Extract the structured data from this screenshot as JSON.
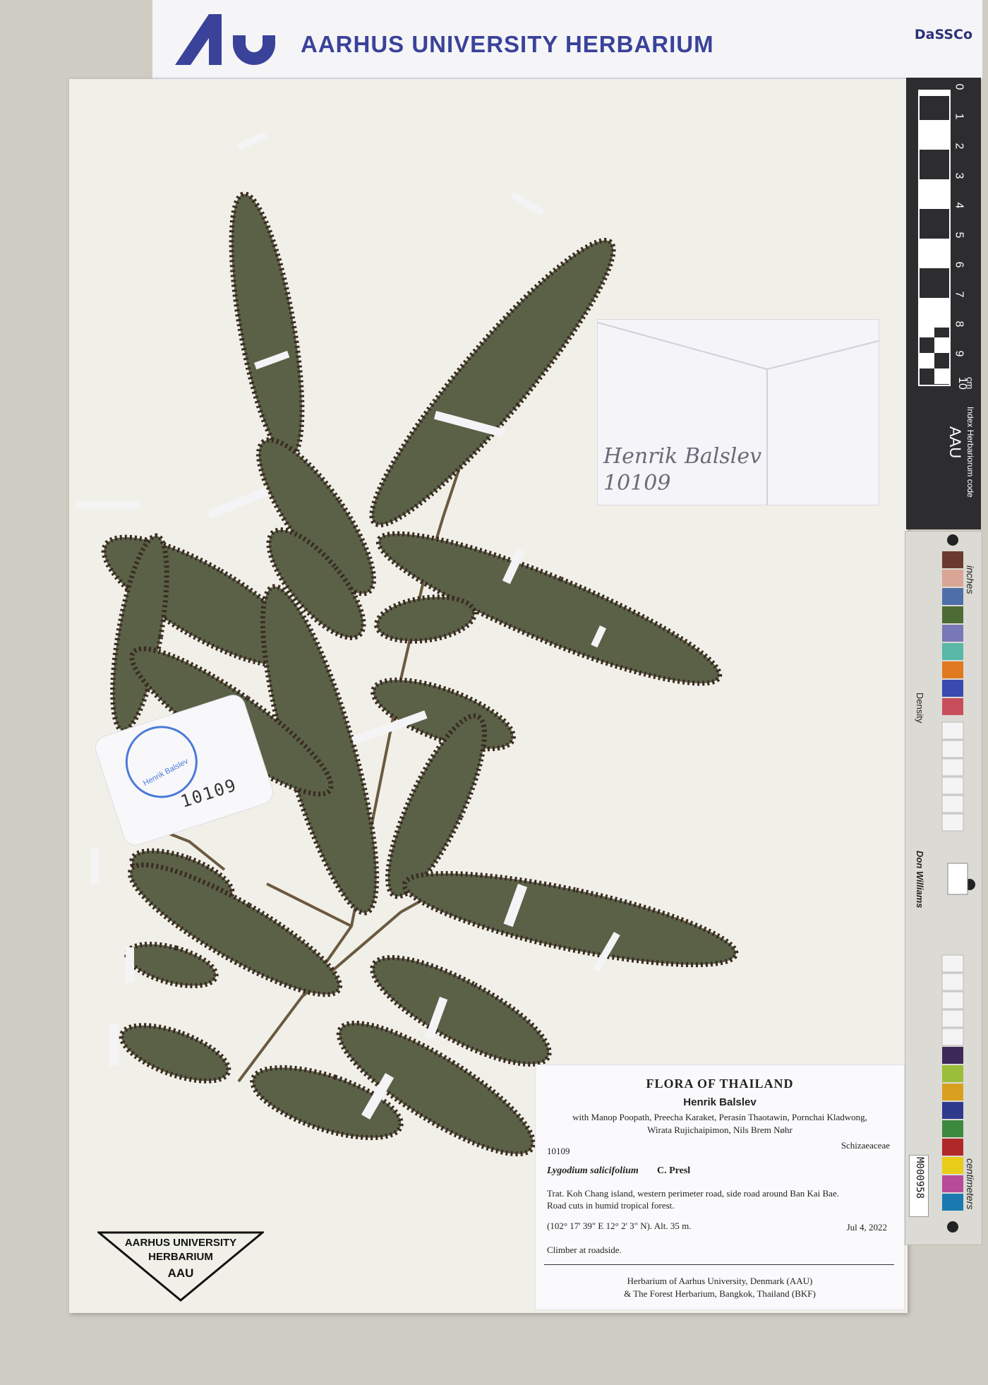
{
  "banner": {
    "title": "AARHUS UNIVERSITY HERBARIUM",
    "partner": "DaSSCo"
  },
  "envelope": {
    "line1": "Henrik Balslev",
    "line2": "10109"
  },
  "tag": {
    "number": "10109",
    "stamp": "Henrik Balslev"
  },
  "ruler": {
    "numbers": [
      "0",
      "1",
      "2",
      "3",
      "4",
      "5",
      "6",
      "7",
      "8",
      "9",
      "10"
    ],
    "unit": "cm",
    "code_label": "Index Herbariorum code",
    "code": "AAU"
  },
  "colorbar": {
    "inches": "inches",
    "centimeters": "centimeters",
    "density": "Density",
    "brand": "Don Williams",
    "barcode": "M000958",
    "swatch_colors": [
      "#6b3a2e",
      "#d9a595",
      "#4f6fa8",
      "#4d6b35",
      "#7878b8",
      "#59b8a8",
      "#e07a20",
      "#3a4ab0",
      "#c84e5c",
      "#3d2a5a",
      "#9bbe3a",
      "#d9a020",
      "#2e3a8c",
      "#3c8a40",
      "#b02828",
      "#e8cc1a",
      "#b84a9a",
      "#1a7ab0"
    ]
  },
  "label": {
    "title": "FLORA OF THAILAND",
    "collector": "Henrik Balslev",
    "with_line1": "with Manop Poopath, Preecha Karaket, Perasin Thaotawin, Pornchai Kladwong,",
    "with_line2": "Wirata Rujichaipimon, Nils Brem Nøhr",
    "family": "Schizaeaceae",
    "number": "10109",
    "species": "Lygodium salicifolium",
    "author": "C. Presl",
    "locality1": "Trat. Koh Chang island, western perimeter road, side road around Ban Kai Bae.",
    "locality2": "Road cuts in humid tropical forest.",
    "coords": "(102° 17' 39\" E 12° 2' 3\" N). Alt. 35 m.",
    "date": "Jul 4, 2022",
    "habit": "Climber at roadside.",
    "footer1": "Herbarium of Aarhus University, Denmark (AAU)",
    "footer2": "& The Forest Herbarium, Bangkok, Thailand (BKF)"
  },
  "stamp_triangle": {
    "line1": "AARHUS UNIVERSITY",
    "line2": "HERBARIUM",
    "line3": "AAU"
  }
}
